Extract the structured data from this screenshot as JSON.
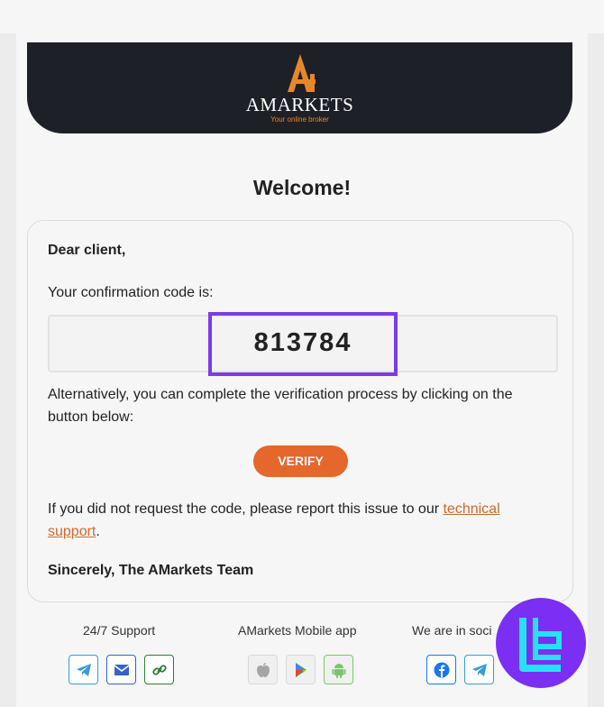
{
  "header": {
    "logo_name": "AMARKETS",
    "logo_tagline": "Your online broker",
    "brand_color": "#1e2027",
    "accent_color": "#e8872a"
  },
  "welcome": "Welcome!",
  "card": {
    "greeting": "Dear client,",
    "code_label": "Your confirmation code is:",
    "code": "813784",
    "alternative_text": "Alternatively, you can complete the verification process by clicking on the button below:",
    "verify_button": "VERIFY",
    "report_text": "If you did not request the code, please report this issue to our ",
    "report_link": "technical support",
    "report_end": ".",
    "signature": "Sincerely, The AMarkets Team"
  },
  "footer": {
    "support_label": "24/7 Support",
    "mobile_label": "AMarkets Mobile app",
    "social_label": "We are in soci",
    "support_icons": [
      "telegram-icon",
      "mail-icon",
      "link-icon"
    ],
    "mobile_icons": [
      "apple-icon",
      "google-play-icon",
      "android-icon"
    ],
    "social_icons": [
      "facebook-icon",
      "telegram-icon"
    ]
  }
}
